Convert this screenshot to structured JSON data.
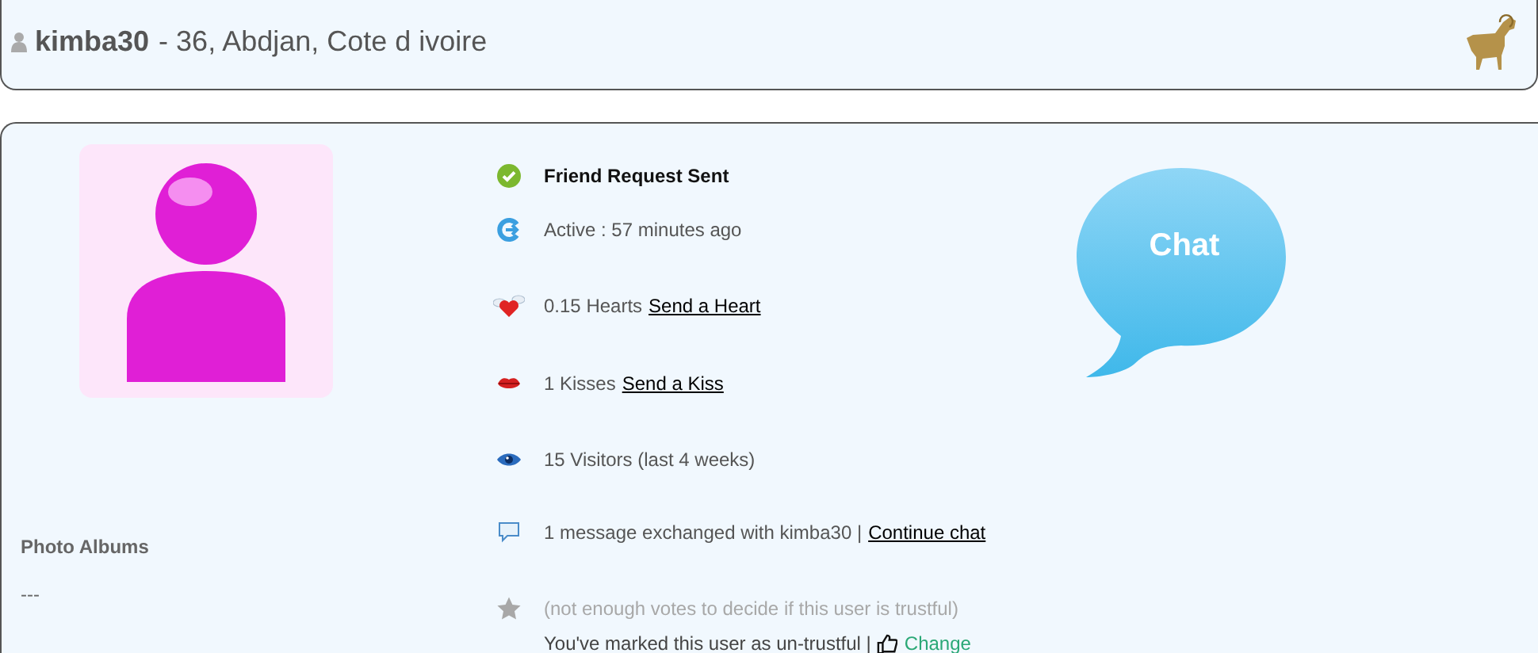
{
  "header": {
    "username": "kimba30",
    "details": "- 36, Abdjan, Cote d ivoire"
  },
  "photo_albums": {
    "title": "Photo Albums",
    "value": "---"
  },
  "rows": [
    {
      "kind": "check",
      "text": "Friend Request Sent"
    },
    {
      "kind": "active",
      "text": "Active : 57 minutes ago"
    },
    {
      "kind": "heart",
      "text": "0.15 Hearts",
      "link": "Send a Heart"
    },
    {
      "kind": "kiss",
      "text": "1 Kisses",
      "link": "Send a Kiss"
    },
    {
      "kind": "eye",
      "text": "15 Visitors (last 4 weeks)"
    },
    {
      "kind": "message",
      "text": "1 message exchanged with kimba30 |",
      "link": "Continue chat"
    },
    {
      "kind": "star",
      "text": "(not enough votes to decide if this user is trustful)"
    }
  ],
  "trust": {
    "text": "You've marked this user as un-trustful |",
    "link": "Change"
  },
  "chat_button": {
    "label": "Chat"
  }
}
